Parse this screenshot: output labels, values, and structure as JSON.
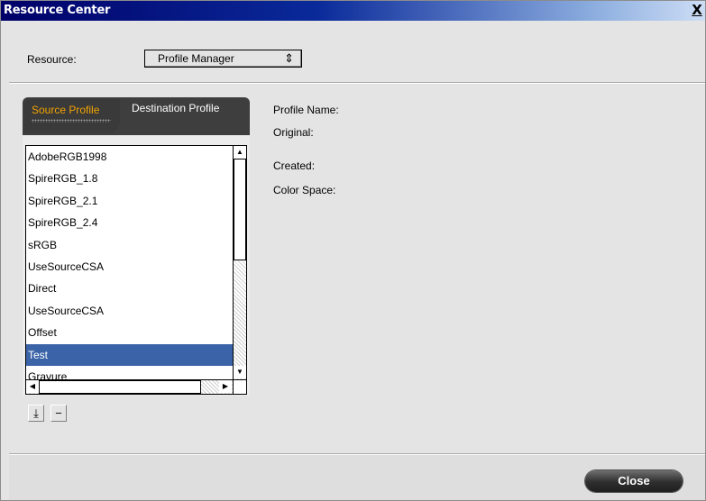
{
  "window": {
    "title": "Resource Center",
    "close_glyph": "X",
    "close_icon": "close-icon"
  },
  "resource": {
    "label": "Resource:",
    "selected": "Profile Manager",
    "arrows_glyph": "⇕"
  },
  "tabs": [
    {
      "label": "Source Profile",
      "active": true,
      "color": "#f5a300"
    },
    {
      "label": "Destination Profile",
      "active": false
    }
  ],
  "profiles": [
    {
      "name": "AdobeRGB1998",
      "selected": false
    },
    {
      "name": "SpireRGB_1.8",
      "selected": false
    },
    {
      "name": "SpireRGB_2.1",
      "selected": false
    },
    {
      "name": "SpireRGB_2.4",
      "selected": false
    },
    {
      "name": "sRGB",
      "selected": false
    },
    {
      "name": "UseSourceCSA",
      "selected": false
    },
    {
      "name": "Direct",
      "selected": false
    },
    {
      "name": "UseSourceCSA",
      "selected": false
    },
    {
      "name": "Offset",
      "selected": false
    },
    {
      "name": "Test",
      "selected": true
    },
    {
      "name": "Gravure",
      "selected": false
    }
  ],
  "list_actions": {
    "add_icon": "import-icon",
    "add_glyph": "⤓",
    "remove_icon": "minus-icon",
    "remove_glyph": "−"
  },
  "info": {
    "profile_name_label": "Profile Name:",
    "original_label": "Original:",
    "created_label": "Created:",
    "color_space_label": "Color Space:"
  },
  "footer": {
    "close_label": "Close"
  },
  "colors": {
    "selection": "#3b63a8",
    "tab_active_text": "#f5a300"
  }
}
